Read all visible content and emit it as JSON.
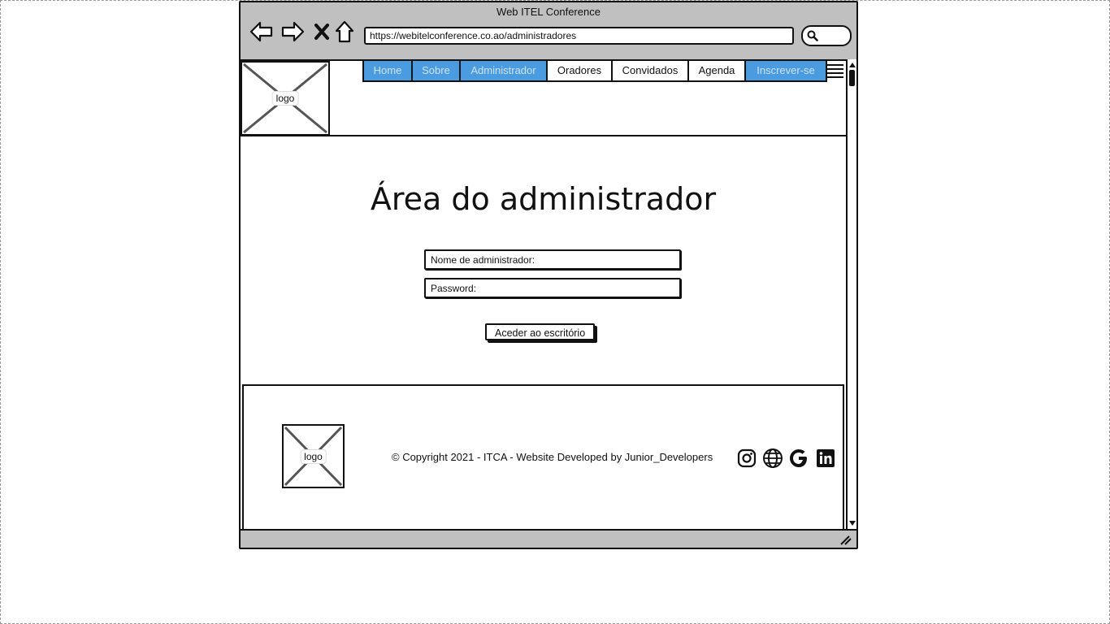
{
  "window": {
    "title": "Web ITEL Conference",
    "url": "https://webitelconference.co.ao/administradores"
  },
  "header": {
    "logo_label": "logo",
    "menu": [
      {
        "label": "Home",
        "style": "link"
      },
      {
        "label": "Sobre",
        "style": "link"
      },
      {
        "label": "Administrador",
        "style": "link"
      },
      {
        "label": "Oradores",
        "style": "plain"
      },
      {
        "label": "Convidados",
        "style": "plain"
      },
      {
        "label": "Agenda",
        "style": "plain"
      },
      {
        "label": "Inscrever-se",
        "style": "link"
      }
    ]
  },
  "main": {
    "title": "Área do administrador",
    "username_placeholder": "Nome de administrador:",
    "password_placeholder": "Password:",
    "submit_label": "Aceder ao escritório"
  },
  "footer": {
    "logo_label": "logo",
    "copyright": "© Copyright 2021 - ITCA - Website Developed by Junior_Developers",
    "social_icons": [
      "instagram-icon",
      "globe-icon",
      "google-icon",
      "linkedin-icon"
    ]
  },
  "colors": {
    "menu_accent": "#4a9be0",
    "chrome": "#c0c0c0"
  }
}
